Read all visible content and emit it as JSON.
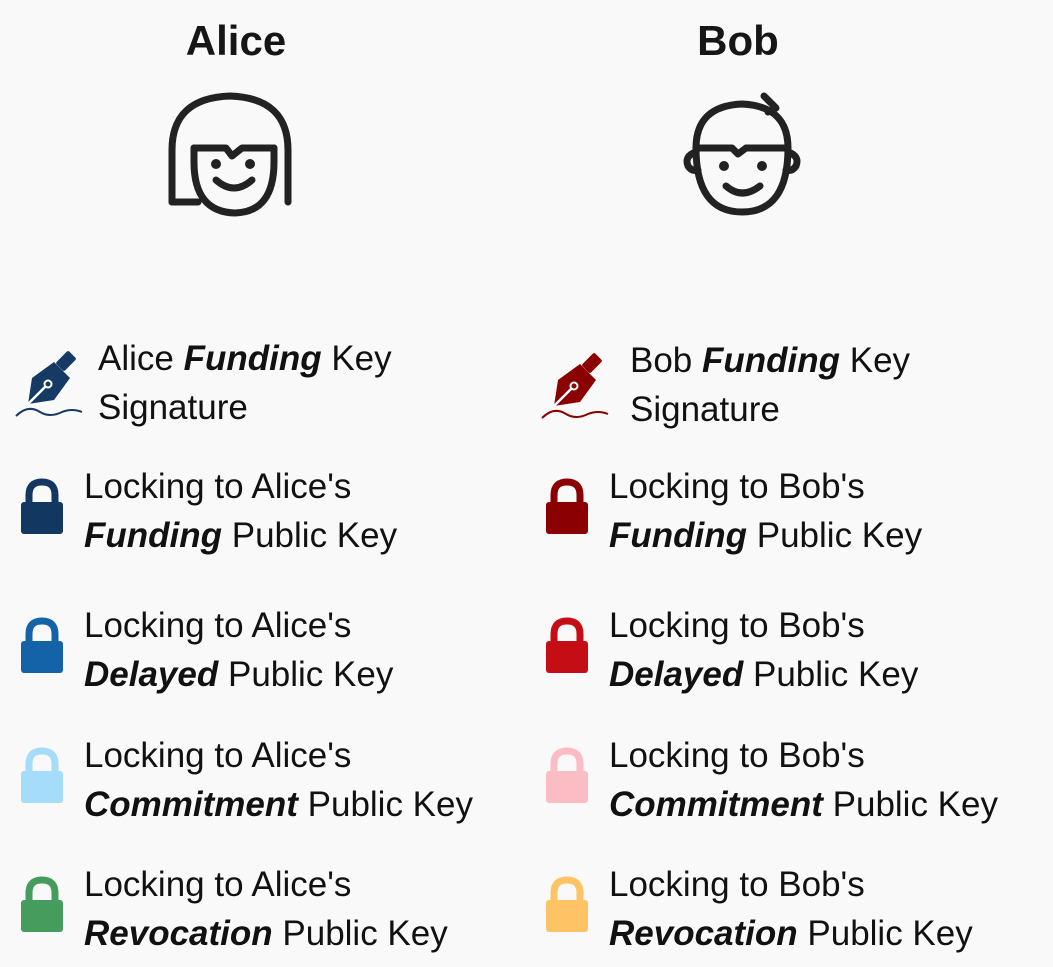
{
  "people": {
    "alice": {
      "name": "Alice"
    },
    "bob": {
      "name": "Bob"
    }
  },
  "colors": {
    "alice_signature": "#163a63",
    "bob_signature": "#8b0000",
    "alice_funding": "#123760",
    "alice_delayed": "#1462a8",
    "alice_commitment": "#a4dcf9",
    "alice_revocation": "#469c5d",
    "bob_funding": "#8b0000",
    "bob_delayed": "#c40d14",
    "bob_commitment": "#fcbcc3",
    "bob_revocation": "#fdc365"
  },
  "alice": {
    "signature": {
      "pre": "Alice ",
      "em": "Funding",
      "post": " Key",
      "line2": "Signature",
      "icon": "fountain-pen-icon"
    },
    "funding": {
      "line1": "Locking to Alice's",
      "em": "Funding",
      "post": " Public Key",
      "icon": "lock-icon"
    },
    "delayed": {
      "line1": "Locking to Alice's",
      "em": "Delayed",
      "post": " Public Key",
      "icon": "lock-icon"
    },
    "commitment": {
      "line1": "Locking to Alice's",
      "em": "Commitment",
      "post": " Public Key",
      "icon": "lock-icon"
    },
    "revocation": {
      "line1": "Locking to Alice's",
      "em": "Revocation",
      "post": " Public Key",
      "icon": "lock-icon"
    }
  },
  "bob": {
    "signature": {
      "pre": "Bob ",
      "em": "Funding",
      "post": " Key",
      "line2": "Signature",
      "icon": "fountain-pen-icon"
    },
    "funding": {
      "line1": "Locking to Bob's",
      "em": "Funding",
      "post": " Public Key",
      "icon": "lock-icon"
    },
    "delayed": {
      "line1": "Locking to Bob's",
      "em": "Delayed",
      "post": " Public Key",
      "icon": "lock-icon"
    },
    "commitment": {
      "line1": "Locking to Bob's",
      "em": "Commitment",
      "post": " Public Key",
      "icon": "lock-icon"
    },
    "revocation": {
      "line1": "Locking to Bob's",
      "em": "Revocation",
      "post": " Public Key",
      "icon": "lock-icon"
    }
  }
}
